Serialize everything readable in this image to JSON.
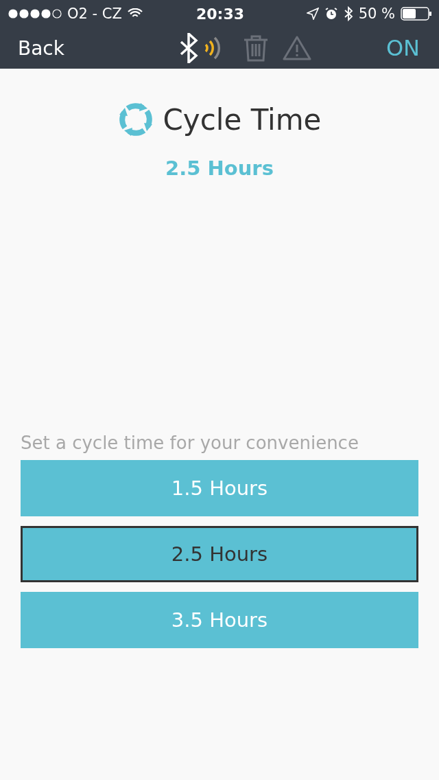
{
  "status_bar": {
    "carrier": "O2 - CZ",
    "time": "20:33",
    "battery": "50 %"
  },
  "nav": {
    "back": "Back",
    "power": "ON"
  },
  "header": {
    "title": "Cycle Time",
    "value": "2.5 Hours"
  },
  "prompt": "Set a cycle time for your convenience",
  "options": [
    {
      "label": "1.5 Hours",
      "selected": false
    },
    {
      "label": "2.5 Hours",
      "selected": true
    },
    {
      "label": "3.5 Hours",
      "selected": false
    }
  ]
}
